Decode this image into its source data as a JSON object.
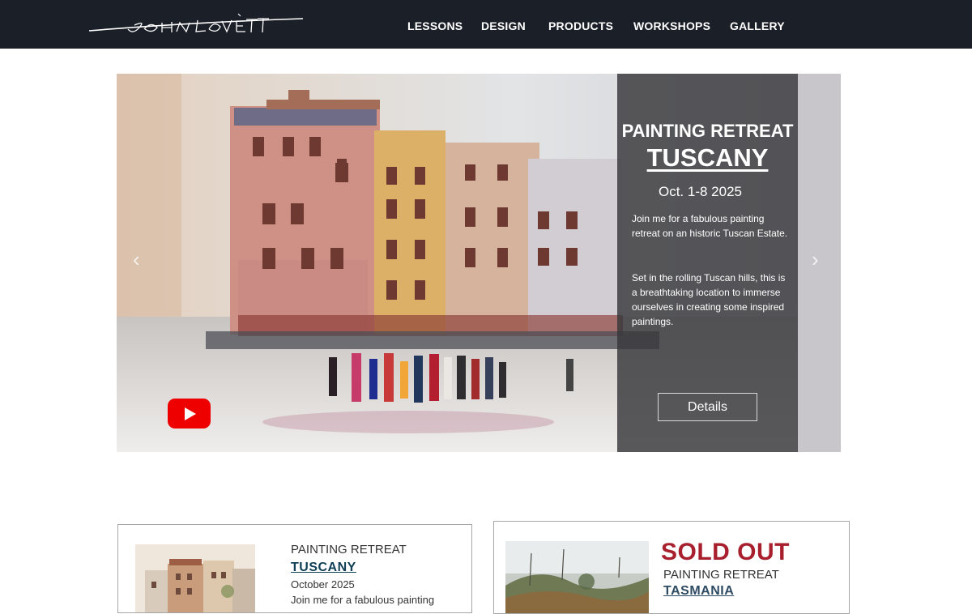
{
  "header": {
    "logo_text": "JOHN LOVETT",
    "nav": [
      "LESSONS",
      "DESIGN",
      "PRODUCTS",
      "WORKSHOPS",
      "GALLERY"
    ]
  },
  "hero": {
    "title_line1": "PAINTING RETREAT",
    "title_line2": "TUSCANY",
    "date": "Oct. 1-8 2025",
    "paragraph1": "Join me for a fabulous painting retreat on an historic Tuscan Estate.",
    "paragraph2": "Set in the rolling Tuscan hills, this is a breathtaking location to immerse ourselves in creating some inspired paintings.",
    "details_button": "Details",
    "prev_arrow": "‹",
    "next_arrow": "›",
    "video_icon": "youtube-play-icon"
  },
  "cards": [
    {
      "label": "PAINTING RETREAT",
      "place": "TUSCANY",
      "date": "October 2025",
      "desc": "Join me for a fabulous painting"
    },
    {
      "status": "SOLD OUT",
      "label": "PAINTING RETREAT",
      "place": "TASMANIA"
    }
  ],
  "colors": {
    "header_bg": "#1b1f28",
    "sold_out": "#a8202e",
    "link": "#0f3f55",
    "youtube": "#ee0000"
  }
}
